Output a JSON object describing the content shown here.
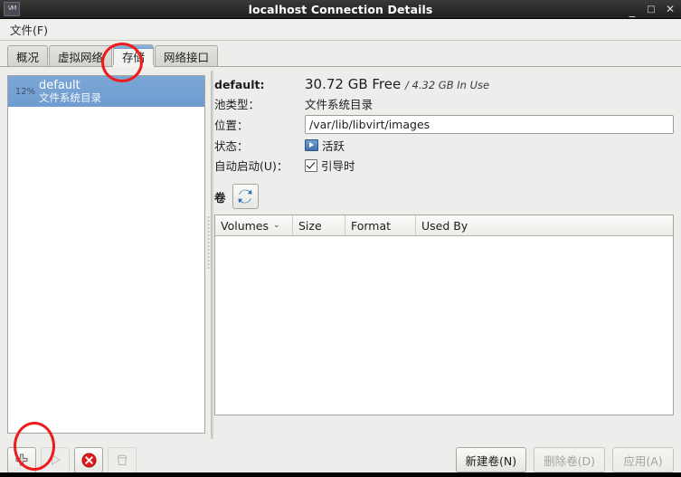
{
  "window": {
    "title": "localhost Connection Details",
    "icon": "app-icon",
    "controls": {
      "minimize": "_",
      "maximize": "□",
      "close": "✕"
    }
  },
  "menubar": {
    "items": [
      {
        "label": "文件(F)",
        "name": "menu-file"
      }
    ]
  },
  "tabs": [
    {
      "label": "概况",
      "name": "tab-overview",
      "selected": false
    },
    {
      "label": "虚拟网络",
      "name": "tab-virtual-networks",
      "selected": false
    },
    {
      "label": "存储",
      "name": "tab-storage",
      "selected": true
    },
    {
      "label": "网络接口",
      "name": "tab-network-interfaces",
      "selected": false
    }
  ],
  "pool_list": {
    "rows": [
      {
        "gauge": "12%",
        "name": "default",
        "type": "文件系统目录",
        "selected": true
      }
    ]
  },
  "details": {
    "name_label": "default:",
    "free": "30.72 GB Free",
    "in_use": "/ 4.32 GB In Use",
    "pool_type_label": "池类型：",
    "pool_type_value": "文件系统目录",
    "location_label": "位置：",
    "location_value": "/var/lib/libvirt/images",
    "state_label": "状态：",
    "state_value": "活跃",
    "autostart_label": "自动启动(U)：",
    "autostart_value": "引导时",
    "autostart_checked": true
  },
  "volumes": {
    "title": "卷",
    "refresh_icon": "refresh-icon",
    "columns": [
      {
        "label": "Volumes",
        "sort": "⌄"
      },
      {
        "label": "Size"
      },
      {
        "label": "Format"
      },
      {
        "label": "Used By"
      }
    ],
    "rows": []
  },
  "toolbar": [
    {
      "name": "add-pool-button",
      "icon": "plus-icon",
      "enabled": true
    },
    {
      "name": "start-pool-button",
      "icon": "play-icon",
      "enabled": false
    },
    {
      "name": "stop-pool-button",
      "icon": "stop-icon",
      "enabled": true
    },
    {
      "name": "delete-pool-button",
      "icon": "trash-icon",
      "enabled": false
    }
  ],
  "footer_buttons": [
    {
      "label": "新建卷(N)",
      "name": "new-volume-button",
      "enabled": true
    },
    {
      "label": "删除卷(D)",
      "name": "delete-volume-button",
      "enabled": false
    },
    {
      "label": "应用(A)",
      "name": "apply-button",
      "enabled": false
    }
  ],
  "colors": {
    "titlebar": "#2b2b2b",
    "selection_blue": "#729fd1",
    "annotation_red": "#ee1c1c",
    "window_bg": "#ededeb"
  }
}
